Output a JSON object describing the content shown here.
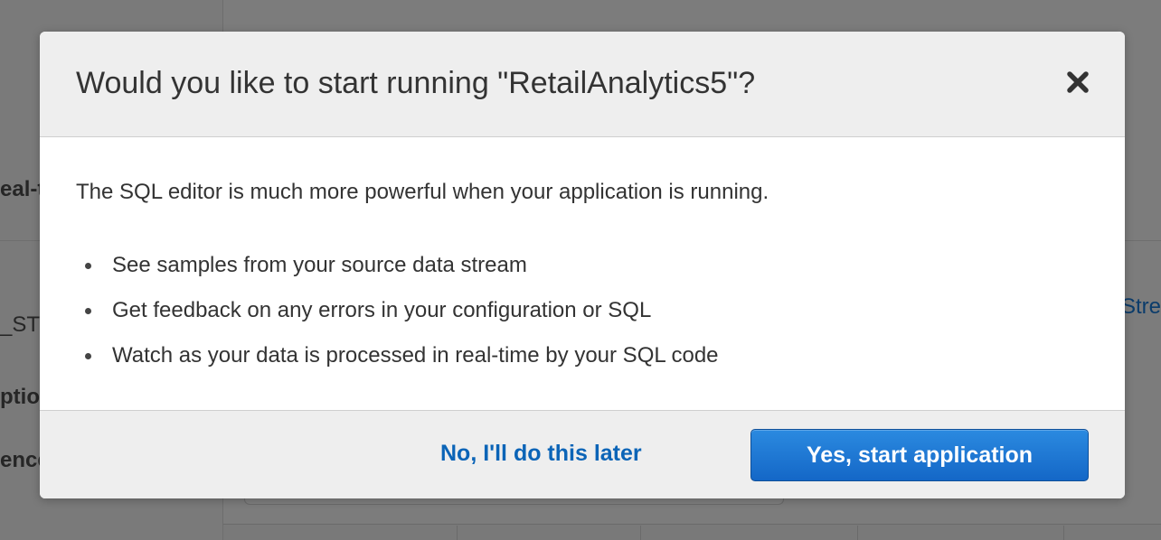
{
  "background": {
    "fragments": {
      "realtime": "eal-t",
      "stream": "_STR",
      "options": "ptio",
      "reference": "ence",
      "link": "Strea"
    }
  },
  "modal": {
    "title": "Would you like to start running \"RetailAnalytics5\"?",
    "close_icon": "close-icon",
    "intro": "The SQL editor is much more powerful when your application is running.",
    "bullets": [
      "See samples from your source data stream",
      "Get feedback on any errors in your configuration or SQL",
      "Watch as your data is processed in real-time by your SQL code"
    ],
    "secondary_label": "No, I'll do this later",
    "primary_label": "Yes, start application"
  },
  "colors": {
    "overlay": "#7c7c7c",
    "header_bg": "#eeeeee",
    "link": "#0b64b7",
    "primary": "#1a73cf",
    "text": "#333333"
  }
}
